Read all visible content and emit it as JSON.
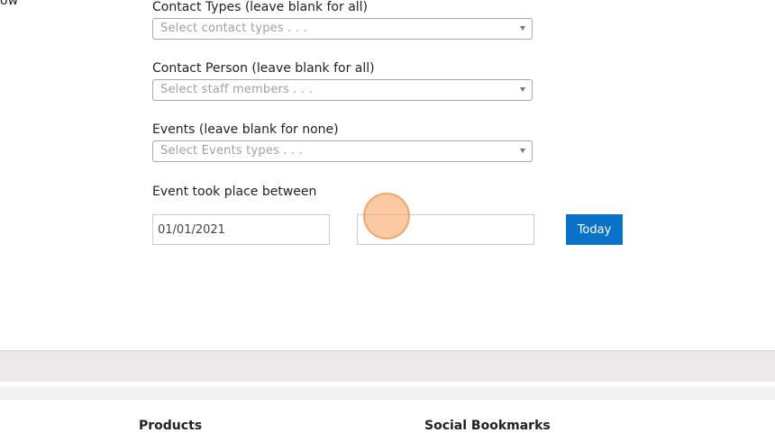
{
  "top_cut_text": "ow",
  "filters": {
    "contact_types": {
      "label": "Contact Types (leave blank for all)",
      "placeholder": "Select contact types . . ."
    },
    "contact_person": {
      "label": "Contact Person (leave blank for all)",
      "placeholder": "Select staff members . . ."
    },
    "events": {
      "label": "Events (leave blank for none)",
      "placeholder": "Select Events types . . ."
    },
    "date_range": {
      "label": "Event took place between",
      "start_value": "01/01/2021",
      "end_value": "",
      "today_label": "Today"
    }
  },
  "footer": {
    "products_heading": "Products",
    "social_heading": "Social Bookmarks"
  },
  "colors": {
    "accent": "#0a73c8",
    "click_marker": "#f7aa6e"
  }
}
